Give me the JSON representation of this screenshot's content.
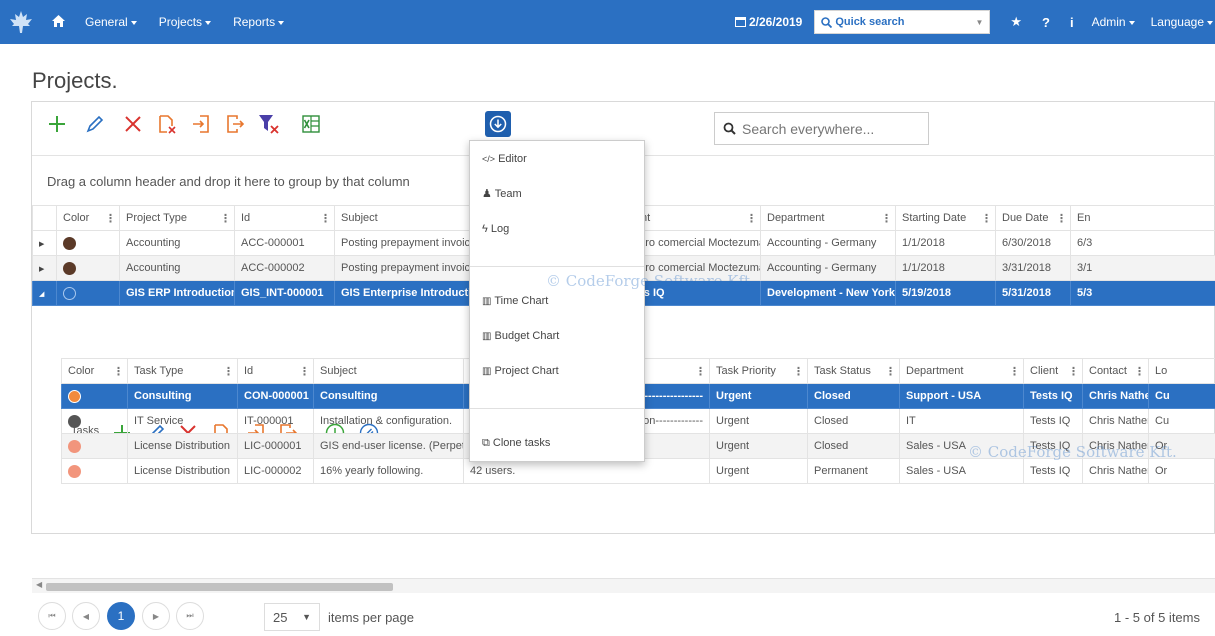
{
  "nav": {
    "general": "General",
    "projects": "Projects",
    "reports": "Reports",
    "date": "2/26/2019",
    "quick_search": "Quick search",
    "help": "?",
    "info": "i",
    "admin": "Admin",
    "language": "Language"
  },
  "page": {
    "title": "Projects."
  },
  "search": {
    "placeholder": "Search everywhere..."
  },
  "group_hint": "Drag a column header and drop it here to group by that column",
  "projects_grid": {
    "headers": [
      "Color",
      "Project Type",
      "Id",
      "Subject",
      "",
      "Client",
      "Department",
      "Starting Date",
      "Due Date",
      "En"
    ],
    "rows": [
      {
        "color": "#5b3a28",
        "type": "Accounting",
        "id": "ACC-000001",
        "subject": "Posting prepayment invoic",
        "desc": "---------------------",
        "client": "Centro comercial Moctezuma",
        "department": "Accounting - Germany",
        "start": "1/1/2018",
        "due": "6/30/2018",
        "end": "6/3"
      },
      {
        "color": "#5b3a28",
        "type": "Accounting",
        "id": "ACC-000002",
        "subject": "Posting prepayment invoic",
        "desc": "---------------------",
        "client": "Centro comercial Moctezuma",
        "department": "Accounting - Germany",
        "start": "1/1/2018",
        "due": "3/31/2018",
        "end": "3/1"
      },
      {
        "color": "#2b70c2",
        "type": "GIS ERP Introduction",
        "id": "GIS_INT-000001",
        "subject": "GIS Enterprise Introductio",
        "desc": "---------------------",
        "client": "Tests IQ",
        "department": "Development - New York",
        "start": "5/19/2018",
        "due": "5/31/2018",
        "end": "5/3"
      }
    ]
  },
  "tasks": {
    "label": "Tasks",
    "headers": [
      "Color",
      "Task Type",
      "Id",
      "Subject",
      "",
      "Task Priority",
      "Task Status",
      "Department",
      "Client",
      "Contact",
      "Lo"
    ],
    "rows": [
      {
        "color": "#f28a3c",
        "type": "Consulting",
        "id": "CON-000001",
        "subject": "Consulting",
        "desc": "---------------------",
        "priority": "Urgent",
        "status": "Closed",
        "department": "Support - USA",
        "client": "Tests IQ",
        "contact": "Chris Nathen",
        "lo": "Cu"
      },
      {
        "color": "#555555",
        "type": "IT Service",
        "id": "IT-000001",
        "subject": "Installation & configuration.",
        "desc": "ration-------------",
        "priority": "Urgent",
        "status": "Closed",
        "department": "IT",
        "client": "Tests IQ",
        "contact": "Chris Nathen",
        "lo": "Cu"
      },
      {
        "color": "#f2957c",
        "type": "License Distribution",
        "id": "LIC-000001",
        "subject": "GIS end-user license. (Perpetu",
        "desc": "",
        "priority": "Urgent",
        "status": "Closed",
        "department": "Sales - USA",
        "client": "Tests IQ",
        "contact": "Chris Nathen",
        "lo": "Or"
      },
      {
        "color": "#f2957c",
        "type": "License Distribution",
        "id": "LIC-000002",
        "subject": "16% yearly following.",
        "desc": "42 users.",
        "priority": "Urgent",
        "status": "Permanent",
        "department": "Sales - USA",
        "client": "Tests IQ",
        "contact": "Chris Nathen",
        "lo": "Or"
      }
    ]
  },
  "dropdown": {
    "editor": "Editor",
    "team": "Team",
    "log": "Log",
    "time_chart": "Time Chart",
    "budget_chart": "Budget Chart",
    "project_chart": "Project Chart",
    "clone_tasks": "Clone tasks"
  },
  "pager": {
    "current": "1",
    "page_size": "25",
    "items_per_page": "items per page",
    "info": "1 - 5 of 5 items"
  },
  "watermark": "© CodeForge Software Kft.",
  "colors": {
    "brand": "#2b70c2",
    "green": "#3aa53a",
    "red": "#d9332e",
    "orange": "#e8772e"
  }
}
